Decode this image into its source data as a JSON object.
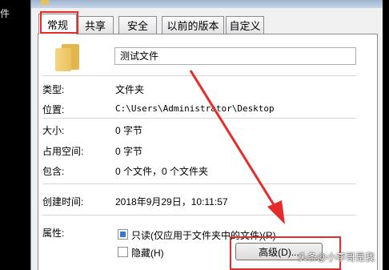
{
  "desktop": {
    "side_label": "件"
  },
  "tabs": [
    {
      "label": "常规",
      "active": true
    },
    {
      "label": "共享"
    },
    {
      "label": "安全"
    },
    {
      "label": "以前的版本"
    },
    {
      "label": "自定义"
    }
  ],
  "folder": {
    "name": "测试文件"
  },
  "props": {
    "type_label": "类型:",
    "type_value": "文件夹",
    "location_label": "位置:",
    "location_value": "C:\\Users\\Administrator\\Desktop",
    "size_label": "大小:",
    "size_value": "0 字节",
    "disk_label": "占用空间:",
    "disk_value": "0 字节",
    "contains_label": "包含:",
    "contains_value": "0 个文件，0 个文件夹",
    "created_label": "创建时间:",
    "created_value": "2018年9月29日，10:11:57",
    "attributes_label": "属性:"
  },
  "attributes": {
    "readonly_label": "只读(仅应用于文件夹中的文件)(R)",
    "readonly_state": "indeterminate",
    "hidden_label": "隐藏(H)",
    "hidden_checked": false,
    "advanced_button": "高级(D)..."
  },
  "watermark": "头条@小李哥是我",
  "colors": {
    "highlight_red": "#e62b2b",
    "tab_border": "#898c95"
  }
}
